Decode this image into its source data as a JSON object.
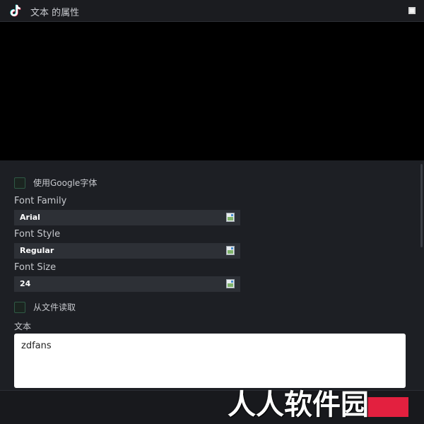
{
  "window": {
    "title": "文本 的属性"
  },
  "form": {
    "google_font_label": "使用Google字体",
    "font_family": {
      "label": "Font Family",
      "value": "Arial"
    },
    "font_style": {
      "label": "Font Style",
      "value": "Regular"
    },
    "font_size": {
      "label": "Font Size",
      "value": "24"
    },
    "read_from_file_label": "从文件读取",
    "text": {
      "label": "文本",
      "value": "zdfans"
    }
  },
  "watermark": {
    "text": "人人软件园"
  },
  "colors": {
    "accent": "#e3203f",
    "background": "#1d1f24",
    "preview": "#000000"
  },
  "icons": {
    "app_logo": "tiktok-note-icon",
    "picker": "image-picker-icon",
    "maximize": "maximize-icon"
  }
}
